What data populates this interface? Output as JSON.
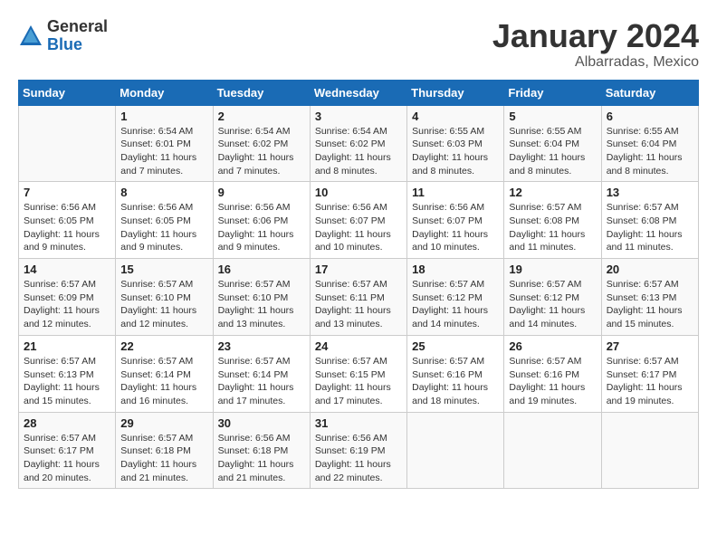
{
  "header": {
    "logo_general": "General",
    "logo_blue": "Blue",
    "month_title": "January 2024",
    "location": "Albarradas, Mexico"
  },
  "calendar": {
    "days_of_week": [
      "Sunday",
      "Monday",
      "Tuesday",
      "Wednesday",
      "Thursday",
      "Friday",
      "Saturday"
    ],
    "weeks": [
      [
        {
          "day": "",
          "info": ""
        },
        {
          "day": "1",
          "info": "Sunrise: 6:54 AM\nSunset: 6:01 PM\nDaylight: 11 hours\nand 7 minutes."
        },
        {
          "day": "2",
          "info": "Sunrise: 6:54 AM\nSunset: 6:02 PM\nDaylight: 11 hours\nand 7 minutes."
        },
        {
          "day": "3",
          "info": "Sunrise: 6:54 AM\nSunset: 6:02 PM\nDaylight: 11 hours\nand 8 minutes."
        },
        {
          "day": "4",
          "info": "Sunrise: 6:55 AM\nSunset: 6:03 PM\nDaylight: 11 hours\nand 8 minutes."
        },
        {
          "day": "5",
          "info": "Sunrise: 6:55 AM\nSunset: 6:04 PM\nDaylight: 11 hours\nand 8 minutes."
        },
        {
          "day": "6",
          "info": "Sunrise: 6:55 AM\nSunset: 6:04 PM\nDaylight: 11 hours\nand 8 minutes."
        }
      ],
      [
        {
          "day": "7",
          "info": "Sunrise: 6:56 AM\nSunset: 6:05 PM\nDaylight: 11 hours\nand 9 minutes."
        },
        {
          "day": "8",
          "info": "Sunrise: 6:56 AM\nSunset: 6:05 PM\nDaylight: 11 hours\nand 9 minutes."
        },
        {
          "day": "9",
          "info": "Sunrise: 6:56 AM\nSunset: 6:06 PM\nDaylight: 11 hours\nand 9 minutes."
        },
        {
          "day": "10",
          "info": "Sunrise: 6:56 AM\nSunset: 6:07 PM\nDaylight: 11 hours\nand 10 minutes."
        },
        {
          "day": "11",
          "info": "Sunrise: 6:56 AM\nSunset: 6:07 PM\nDaylight: 11 hours\nand 10 minutes."
        },
        {
          "day": "12",
          "info": "Sunrise: 6:57 AM\nSunset: 6:08 PM\nDaylight: 11 hours\nand 11 minutes."
        },
        {
          "day": "13",
          "info": "Sunrise: 6:57 AM\nSunset: 6:08 PM\nDaylight: 11 hours\nand 11 minutes."
        }
      ],
      [
        {
          "day": "14",
          "info": "Sunrise: 6:57 AM\nSunset: 6:09 PM\nDaylight: 11 hours\nand 12 minutes."
        },
        {
          "day": "15",
          "info": "Sunrise: 6:57 AM\nSunset: 6:10 PM\nDaylight: 11 hours\nand 12 minutes."
        },
        {
          "day": "16",
          "info": "Sunrise: 6:57 AM\nSunset: 6:10 PM\nDaylight: 11 hours\nand 13 minutes."
        },
        {
          "day": "17",
          "info": "Sunrise: 6:57 AM\nSunset: 6:11 PM\nDaylight: 11 hours\nand 13 minutes."
        },
        {
          "day": "18",
          "info": "Sunrise: 6:57 AM\nSunset: 6:12 PM\nDaylight: 11 hours\nand 14 minutes."
        },
        {
          "day": "19",
          "info": "Sunrise: 6:57 AM\nSunset: 6:12 PM\nDaylight: 11 hours\nand 14 minutes."
        },
        {
          "day": "20",
          "info": "Sunrise: 6:57 AM\nSunset: 6:13 PM\nDaylight: 11 hours\nand 15 minutes."
        }
      ],
      [
        {
          "day": "21",
          "info": "Sunrise: 6:57 AM\nSunset: 6:13 PM\nDaylight: 11 hours\nand 15 minutes."
        },
        {
          "day": "22",
          "info": "Sunrise: 6:57 AM\nSunset: 6:14 PM\nDaylight: 11 hours\nand 16 minutes."
        },
        {
          "day": "23",
          "info": "Sunrise: 6:57 AM\nSunset: 6:14 PM\nDaylight: 11 hours\nand 17 minutes."
        },
        {
          "day": "24",
          "info": "Sunrise: 6:57 AM\nSunset: 6:15 PM\nDaylight: 11 hours\nand 17 minutes."
        },
        {
          "day": "25",
          "info": "Sunrise: 6:57 AM\nSunset: 6:16 PM\nDaylight: 11 hours\nand 18 minutes."
        },
        {
          "day": "26",
          "info": "Sunrise: 6:57 AM\nSunset: 6:16 PM\nDaylight: 11 hours\nand 19 minutes."
        },
        {
          "day": "27",
          "info": "Sunrise: 6:57 AM\nSunset: 6:17 PM\nDaylight: 11 hours\nand 19 minutes."
        }
      ],
      [
        {
          "day": "28",
          "info": "Sunrise: 6:57 AM\nSunset: 6:17 PM\nDaylight: 11 hours\nand 20 minutes."
        },
        {
          "day": "29",
          "info": "Sunrise: 6:57 AM\nSunset: 6:18 PM\nDaylight: 11 hours\nand 21 minutes."
        },
        {
          "day": "30",
          "info": "Sunrise: 6:56 AM\nSunset: 6:18 PM\nDaylight: 11 hours\nand 21 minutes."
        },
        {
          "day": "31",
          "info": "Sunrise: 6:56 AM\nSunset: 6:19 PM\nDaylight: 11 hours\nand 22 minutes."
        },
        {
          "day": "",
          "info": ""
        },
        {
          "day": "",
          "info": ""
        },
        {
          "day": "",
          "info": ""
        }
      ]
    ]
  }
}
